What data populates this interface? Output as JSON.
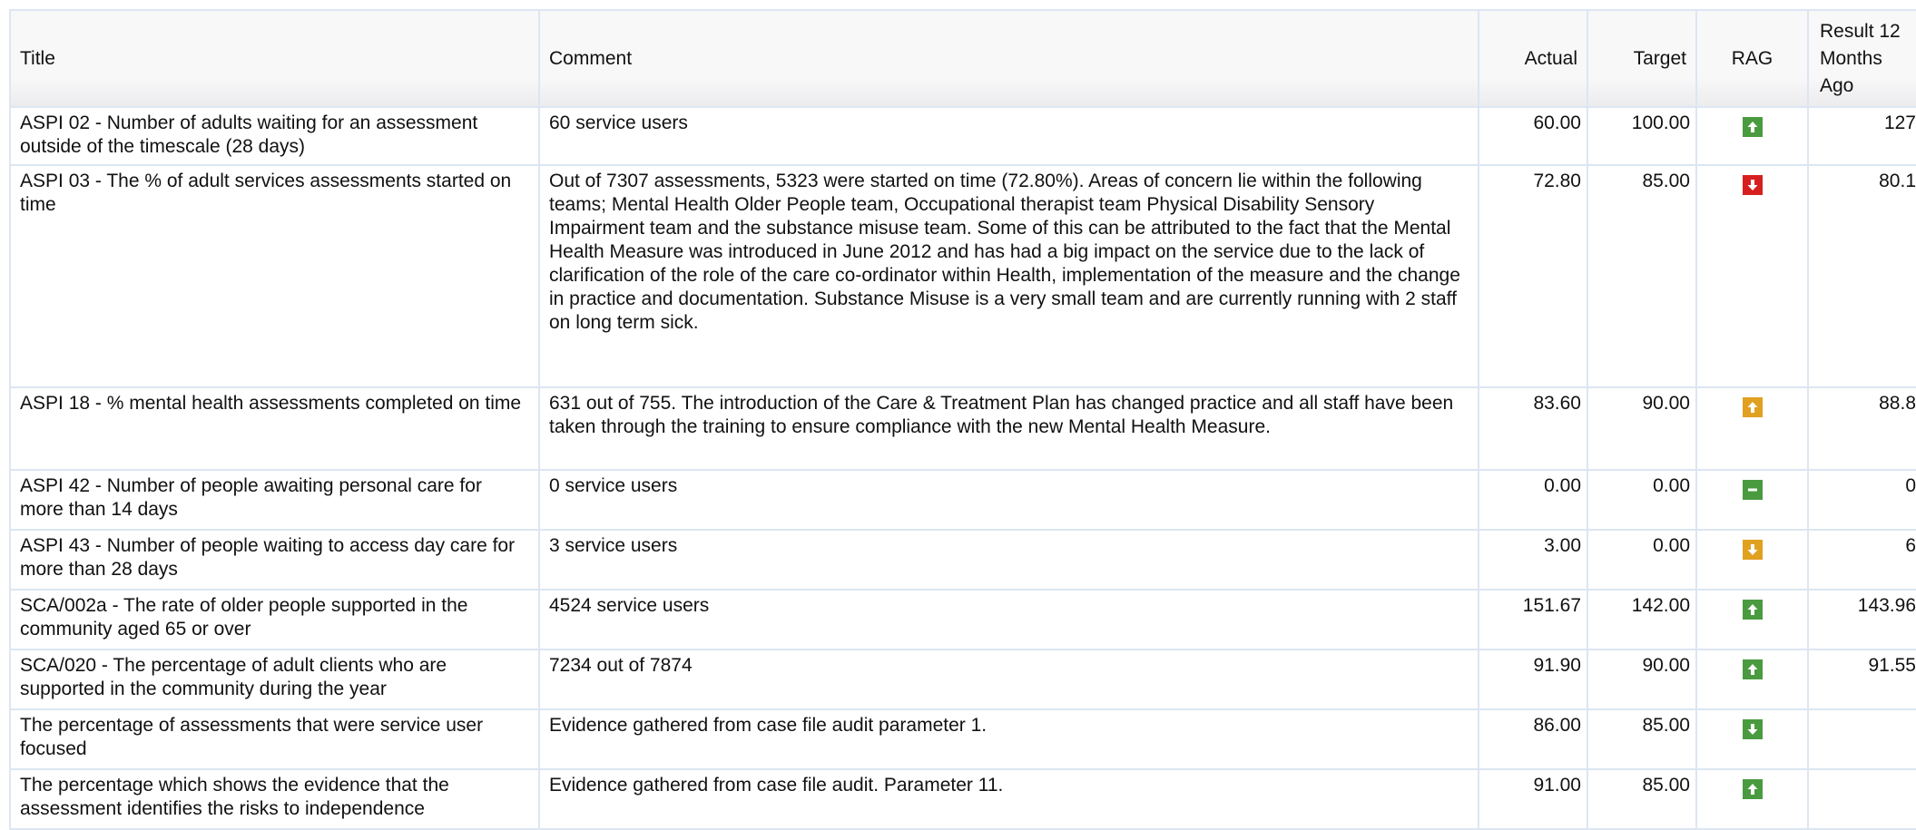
{
  "columns": {
    "title": "Title",
    "comment": "Comment",
    "actual": "Actual",
    "target": "Target",
    "rag": "RAG",
    "prev": "Result 12 Months Ago"
  },
  "colors": {
    "green": "#4a9a3f",
    "red": "#d62020",
    "amber": "#e0a020",
    "border": "#dce6f2"
  },
  "rows": [
    {
      "title": "ASPI 02 - Number of adults waiting for an assessment outside of the timescale (28 days)",
      "comment": "60 service users",
      "actual": "60.00",
      "target": "100.00",
      "rag": "green-up-icon",
      "prev": "127"
    },
    {
      "title": "ASPI 03 - The % of adult services assessments started on time",
      "comment": "Out of 7307 assessments, 5323 were started on time (72.80%). Areas of concern lie within the following teams; Mental Health Older People team, Occupational therapist team Physical Disability Sensory Impairment team and the substance misuse team. Some of this can be attributed to the fact that the Mental Health Measure was introduced in June 2012 and has had a big impact on the service due to the lack of clarification of the role of the care co-ordinator within Health, implementation of the measure and the change in practice and documentation. Substance Misuse is a very small team and are currently running with 2 staff on long term sick.",
      "actual": "72.80",
      "target": "85.00",
      "rag": "red-down-icon",
      "prev": "80.1"
    },
    {
      "title": "ASPI 18 - % mental health assessments completed on time",
      "comment": "631 out of 755. The introduction of the Care & Treatment Plan has changed practice and all staff have been taken through the training to ensure compliance with the new Mental Health Measure.",
      "actual": "83.60",
      "target": "90.00",
      "rag": "amber-up-icon",
      "prev": "88.8"
    },
    {
      "title": "ASPI 42 - Number of people awaiting personal care for more than 14 days",
      "comment": "0 service users",
      "actual": "0.00",
      "target": "0.00",
      "rag": "green-level-icon",
      "prev": "0"
    },
    {
      "title": "ASPI 43 - Number of people waiting to access day care for more than 28 days",
      "comment": "3 service users",
      "actual": "3.00",
      "target": "0.00",
      "rag": "amber-down-icon",
      "prev": "6"
    },
    {
      "title": "SCA/002a - The rate of older people supported in the community aged 65 or over",
      "comment": "4524 service users",
      "actual": "151.67",
      "target": "142.00",
      "rag": "green-up-icon",
      "prev": "143.96"
    },
    {
      "title": "SCA/020 - The percentage of adult clients who are supported in the community during the year",
      "comment": "7234 out of 7874",
      "actual": "91.90",
      "target": "90.00",
      "rag": "green-up-icon",
      "prev": "91.55"
    },
    {
      "title": "The percentage of assessments that were service user focused",
      "comment": "Evidence gathered from case file audit parameter 1.",
      "actual": "86.00",
      "target": "85.00",
      "rag": "green-down-icon",
      "prev": ""
    },
    {
      "title": "The percentage which shows the evidence that the assessment identifies the risks to independence",
      "comment": "Evidence gathered from case file audit. Parameter 11.",
      "actual": "91.00",
      "target": "85.00",
      "rag": "green-up-icon",
      "prev": ""
    }
  ]
}
